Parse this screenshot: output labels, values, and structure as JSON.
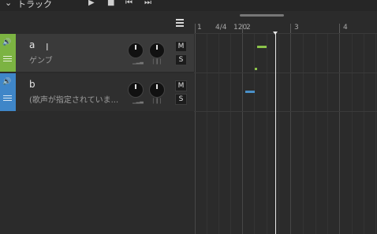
{
  "header": {
    "title": "トラック",
    "buttons": [
      "play-icon",
      "stop-icon",
      "rewind-icon",
      "forward-icon"
    ]
  },
  "ruler": {
    "labels": [
      "1",
      "4/4",
      "120",
      "2",
      "3",
      "4"
    ]
  },
  "tracks": [
    {
      "name": "a",
      "singer": "ゲンブ",
      "color": "#7cb342",
      "mute_label": "M",
      "solo_label": "S"
    },
    {
      "name": "b",
      "singer": "(歌声が指定されていま...",
      "color": "#3f86c8",
      "mute_label": "M",
      "solo_label": "S"
    }
  ],
  "colors": {
    "track_a": "#7cb342",
    "track_b": "#3f86c8",
    "note_a": "#8bc34a",
    "note_b": "#4a90c8"
  }
}
